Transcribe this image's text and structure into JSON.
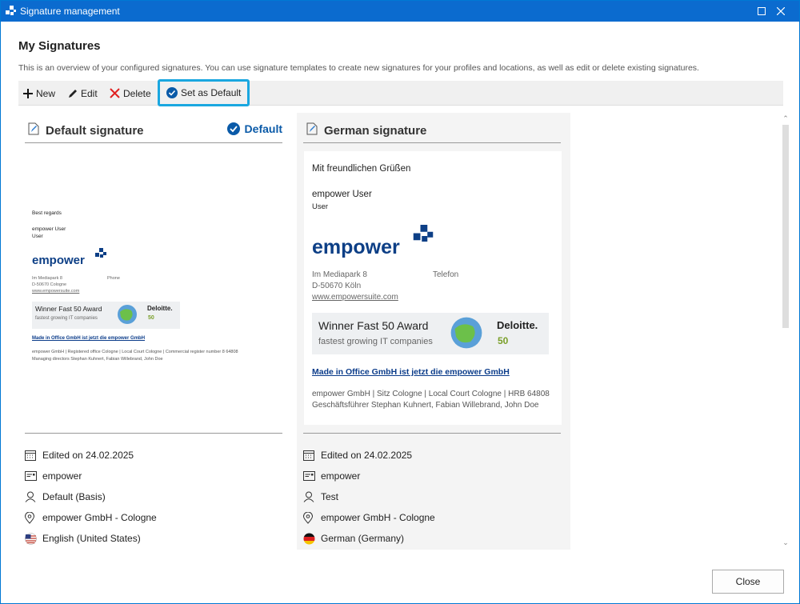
{
  "window": {
    "title": "Signature management",
    "accent": "#0b6bcf"
  },
  "page": {
    "heading": "My Signatures",
    "description": "This is an overview of your configured signatures. You can use signature templates to create new signatures for your profiles and locations, as well as edit or delete existing signatures."
  },
  "toolbar": {
    "new_label": "New",
    "edit_label": "Edit",
    "delete_label": "Delete",
    "set_default_label": "Set as Default"
  },
  "signatures": [
    {
      "name": "Default signature",
      "default_label": "Default",
      "preview": {
        "greeting": "Best regards",
        "user_name": "empower User",
        "user_title": "User",
        "logo_text": "empower",
        "address1": "Im Mediapark 8",
        "address2": "D-50670 Cologne",
        "phone_label": "Phone",
        "website": "www.empowersuite.com",
        "banner_title": "Winner Fast 50 Award",
        "banner_sub": "fastest growing IT companies",
        "banner_brand": "Deloitte.",
        "banner_num": "50",
        "made_in": "Made in Office GmbH ist jetzt die empower GmbH",
        "footer1": "empower GmbH | Registered office Cologne | Local Court Cologne | Commercial register number 8 64808",
        "footer2": "Managing directors Stephan Kuhnert, Fabian Willebrand, John Doe"
      },
      "meta": {
        "edited": "Edited on 24.02.2025",
        "account": "empower",
        "profile": "Default (Basis)",
        "location": "empower GmbH - Cologne",
        "language": "English (United States)"
      }
    },
    {
      "name": "German signature",
      "preview": {
        "greeting": "Mit freundlichen Grüßen",
        "user_name": "empower User",
        "user_title": "User",
        "logo_text": "empower",
        "address1": "Im Mediapark 8",
        "address2": "D-50670 Köln",
        "phone_label": "Telefon",
        "website": "www.empowersuite.com",
        "banner_title": "Winner Fast 50 Award",
        "banner_sub": "fastest growing IT companies",
        "banner_brand": "Deloitte.",
        "banner_num": "50",
        "made_in": "Made in Office GmbH ist jetzt die empower GmbH",
        "footer1": "empower GmbH | Sitz Cologne | Local Court Cologne | HRB 64808",
        "footer2": "Geschäftsführer Stephan Kuhnert, Fabian Willebrand, John Doe"
      },
      "meta": {
        "edited": "Edited on 24.02.2025",
        "account": "empower",
        "profile": "Test",
        "location": "empower GmbH - Cologne",
        "language": "German (Germany)"
      }
    }
  ],
  "footer": {
    "close_label": "Close"
  }
}
